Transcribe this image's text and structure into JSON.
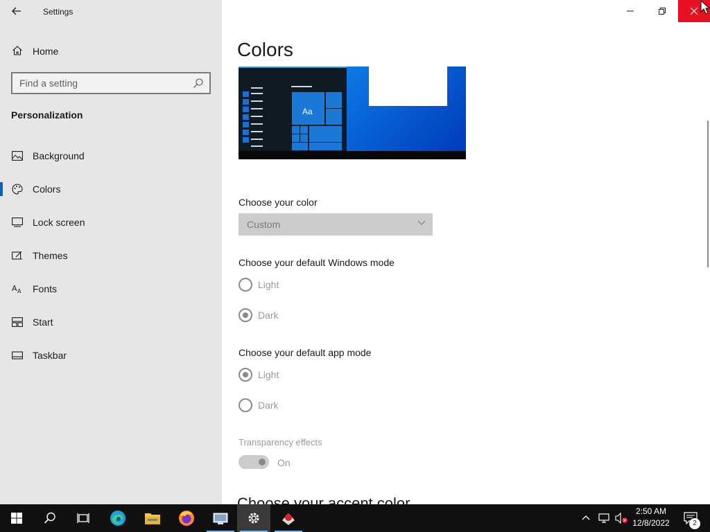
{
  "window": {
    "title": "Settings"
  },
  "sidebar": {
    "home_label": "Home",
    "search_placeholder": "Find a setting",
    "section_heading": "Personalization",
    "items": [
      {
        "label": "Background",
        "icon": "picture-icon"
      },
      {
        "label": "Colors",
        "icon": "palette-icon",
        "active": true
      },
      {
        "label": "Lock screen",
        "icon": "lock-screen-icon"
      },
      {
        "label": "Themes",
        "icon": "themes-icon"
      },
      {
        "label": "Fonts",
        "icon": "fonts-icon"
      },
      {
        "label": "Start",
        "icon": "start-icon"
      },
      {
        "label": "Taskbar",
        "icon": "taskbar-icon"
      }
    ]
  },
  "main": {
    "title": "Colors",
    "preview_tile_label": "Aa",
    "choose_color_label": "Choose your color",
    "choose_color_value": "Custom",
    "windows_mode": {
      "label": "Choose your default Windows mode",
      "options": [
        "Light",
        "Dark"
      ],
      "selected": "Dark"
    },
    "app_mode": {
      "label": "Choose your default app mode",
      "options": [
        "Light",
        "Dark"
      ],
      "selected": "Light"
    },
    "transparency": {
      "label": "Transparency effects",
      "state": "On"
    },
    "accent_heading": "Choose your accent color"
  },
  "taskbar": {
    "apps": [
      "start-icon",
      "search-icon",
      "task-view-icon",
      "edge-icon",
      "file-explorer-icon",
      "firefox-icon",
      "network-app-icon",
      "settings-icon",
      "red-app-icon"
    ],
    "clock_time": "2:50 AM",
    "clock_date": "12/8/2022",
    "notification_count": "2"
  },
  "colors": {
    "accent": "#0067c0",
    "close_button": "#e81123",
    "sidebar_bg": "#e6e6e6",
    "taskbar_bg": "#101010"
  }
}
